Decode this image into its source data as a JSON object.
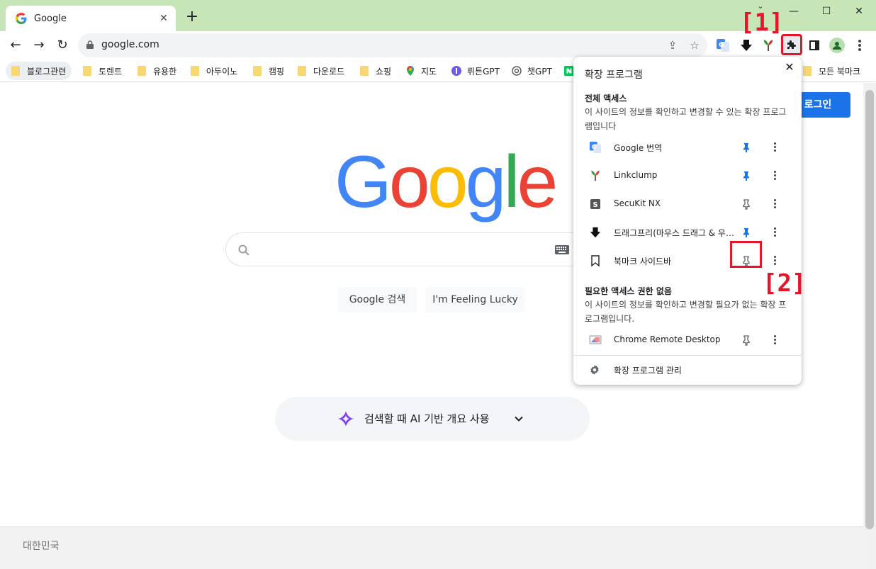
{
  "colors": {
    "tabstrip": "#c6e6b8",
    "accent": "#1a73e8",
    "annotation": "#e8152a",
    "pinned": "#1a73e8",
    "unpinned": "#5f6368"
  },
  "tab": {
    "title": "Google",
    "close": "✕",
    "new_tab": "+"
  },
  "window_controls": {
    "tab_search": "⌄",
    "minimize": "—",
    "maximize": "☐",
    "close": "✕"
  },
  "toolbar": {
    "back": "←",
    "forward": "→",
    "reload": "↻",
    "url": "google.com",
    "share": "⇪",
    "star": "☆"
  },
  "annotations": {
    "one": "[1]",
    "two": "[2]"
  },
  "bookmarks": [
    {
      "label": "블로그관련",
      "icon": "folder-icon"
    },
    {
      "label": "토렌트",
      "icon": "folder-icon"
    },
    {
      "label": "유용한",
      "icon": "folder-icon"
    },
    {
      "label": "아두이노",
      "icon": "folder-icon"
    },
    {
      "label": "캠핑",
      "icon": "folder-icon"
    },
    {
      "label": "다운로드",
      "icon": "folder-icon"
    },
    {
      "label": "쇼핑",
      "icon": "folder-icon"
    },
    {
      "label": "지도",
      "icon": "maps-icon"
    },
    {
      "label": "뤼튼GPT",
      "icon": "wrtn-icon"
    },
    {
      "label": "챗GPT",
      "icon": "chatgpt-icon"
    },
    {
      "label": "모든 북마크",
      "icon": "folder-icon"
    }
  ],
  "page": {
    "signin": "로그인",
    "logo": {
      "G": "G",
      "o1": "o",
      "o2": "o",
      "g": "g",
      "l": "l",
      "e": "e"
    },
    "logo_colors": {
      "blue": "#4285f4",
      "red": "#ea4335",
      "yellow": "#fbbc05",
      "green": "#34a853"
    },
    "google_search": "Google 검색",
    "lucky": "I'm Feeling Lucky",
    "ai_overview": "검색할 때 AI 기반 개요 사용",
    "footer": "대한민국"
  },
  "popup": {
    "title": "확장 프로그램",
    "close": "✕",
    "full_access_title": "전체 액세스",
    "full_access_desc": "이 사이트의 정보를 확인하고 변경할 수 있는 확장 프로그램입니다",
    "full_access_items": [
      {
        "name": "Google 번역",
        "icon": "google-translate-icon",
        "pinned": true
      },
      {
        "name": "Linkclump",
        "icon": "linkclump-icon",
        "pinned": true
      },
      {
        "name": "SecuKit NX",
        "icon": "secukit-icon",
        "pinned": false
      },
      {
        "name": "드래그프리(마우스 드래그 & 우클릭 해제)",
        "icon": "dragfree-icon",
        "pinned": true
      },
      {
        "name": "북마크 사이드바",
        "icon": "bookmark-icon",
        "pinned": false
      }
    ],
    "no_access_title": "필요한 액세스 권한 없음",
    "no_access_desc": "이 사이트의 정보를 확인하고 변경할 필요가 없는 확장 프로그램입니다.",
    "no_access_items": [
      {
        "name": "Chrome Remote Desktop",
        "icon": "remote-desktop-icon",
        "pinned": false
      }
    ],
    "manage": "확장 프로그램 관리"
  }
}
